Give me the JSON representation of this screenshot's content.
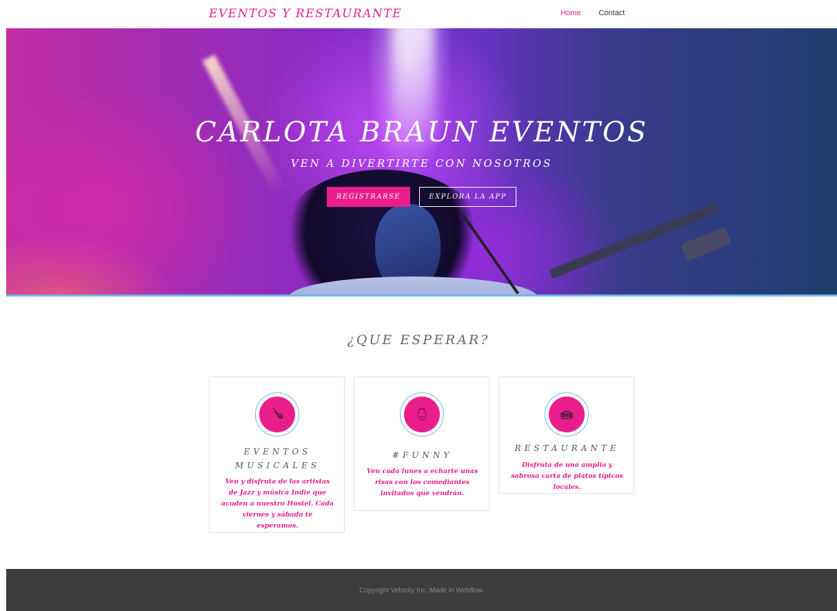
{
  "nav": {
    "brand": "EVENTOS Y RESTAURANTE",
    "links": [
      {
        "label": "Home",
        "active": true
      },
      {
        "label": "Contact",
        "active": false
      }
    ]
  },
  "hero": {
    "title": "CARLOTA BRAUN EVENTOS",
    "subtitle": "VEN A DIVERTIRTE CON NOSOTROS",
    "primary_button": "REGISTRARSE",
    "secondary_button": "EXPLORA LA APP"
  },
  "section": {
    "title": "¿QUE ESPERAR?",
    "cards": [
      {
        "icon": "saxophone-icon",
        "heading": "EVENTOS MUSICALES",
        "text": "Ven y disfruta de las artistas de Jazz y música Indie que acuden a nuestro Hostel. Cada viernes y sábado te esperamos."
      },
      {
        "icon": "comedian-face-icon",
        "heading": "#FUNNY",
        "text": "Ven cada lunes a echarte unas risas con los comediantes invitados que vendrán."
      },
      {
        "icon": "burger-icon",
        "heading": "RESTAURANTE",
        "text": "Disfruta de una amplia y sabrosa carta de platos típicos locales."
      }
    ]
  },
  "footer": {
    "text": "Copyright Velocity Inc. Made in Webflow."
  },
  "colors": {
    "accent": "#e91e8c",
    "ring": "#6fb7ee",
    "footer_bg": "#3d3d3d"
  }
}
